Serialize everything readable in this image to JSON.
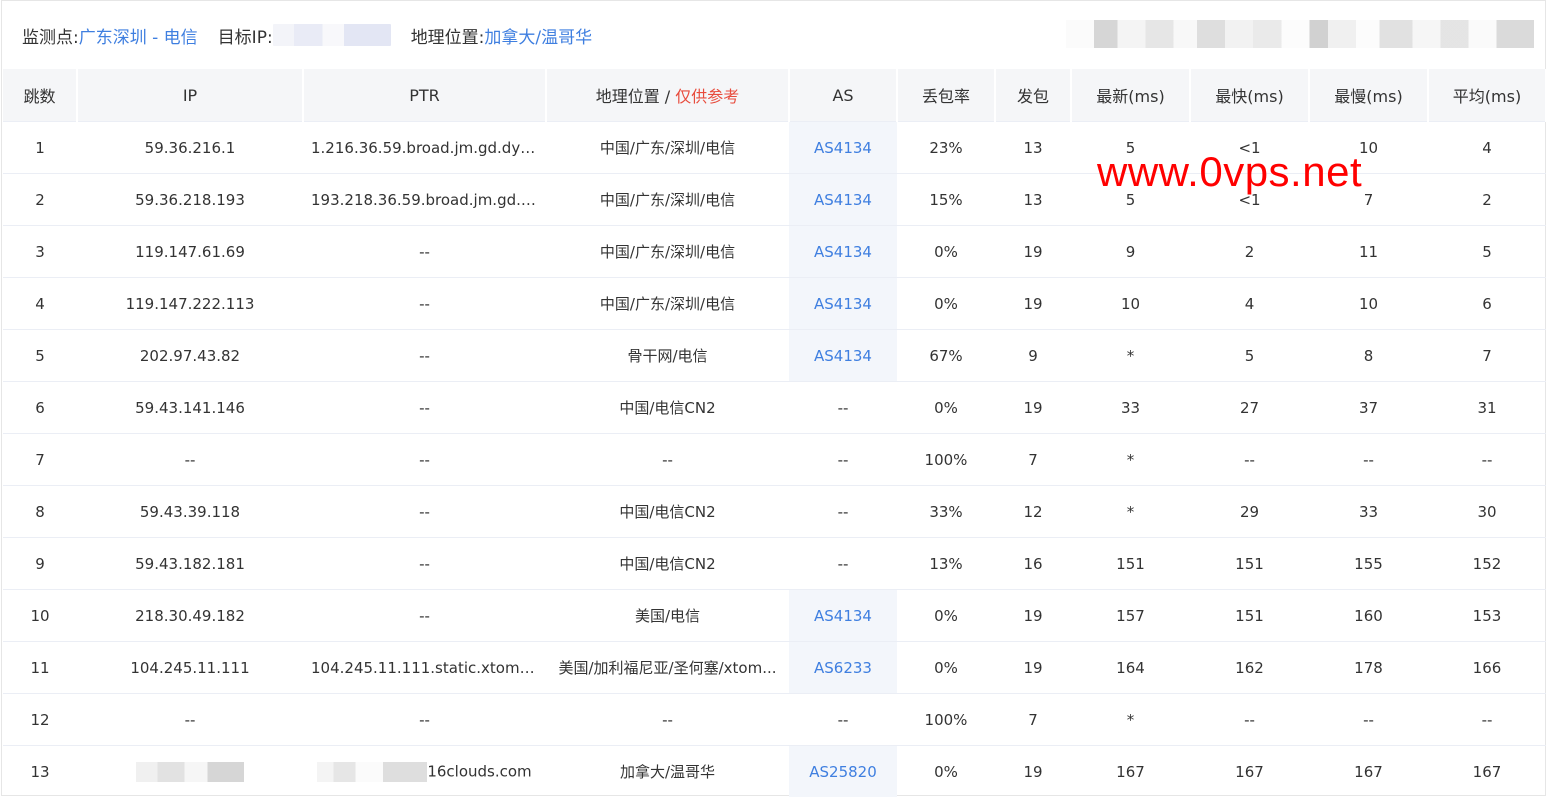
{
  "header": {
    "monitor_label": "监测点:",
    "monitor_value": "广东深圳 - 电信",
    "target_label": "目标IP:",
    "geo_label": "地理位置:",
    "geo_value": "加拿大/温哥华"
  },
  "table": {
    "columns": {
      "hop": "跳数",
      "ip": "IP",
      "ptr": "PTR",
      "geo": "地理位置 /",
      "geo_note": "仅供参考",
      "as": "AS",
      "loss": "丢包率",
      "sent": "发包",
      "last": "最新(ms)",
      "best": "最快(ms)",
      "worst": "最慢(ms)",
      "avg": "平均(ms)"
    },
    "rows": [
      {
        "hop": "1",
        "ip": "59.36.216.1",
        "ptr": "1.216.36.59.broad.jm.gd.dyn...",
        "geo": "中国/广东/深圳/电信",
        "as": "AS4134",
        "loss": "23%",
        "sent": "13",
        "last": "5",
        "best": "<1",
        "worst": "10",
        "avg": "4"
      },
      {
        "hop": "2",
        "ip": "59.36.218.193",
        "ptr": "193.218.36.59.broad.jm.gd.d...",
        "geo": "中国/广东/深圳/电信",
        "as": "AS4134",
        "loss": "15%",
        "sent": "13",
        "last": "5",
        "best": "<1",
        "worst": "7",
        "avg": "2"
      },
      {
        "hop": "3",
        "ip": "119.147.61.69",
        "ptr": "--",
        "geo": "中国/广东/深圳/电信",
        "as": "AS4134",
        "loss": "0%",
        "sent": "19",
        "last": "9",
        "best": "2",
        "worst": "11",
        "avg": "5"
      },
      {
        "hop": "4",
        "ip": "119.147.222.113",
        "ptr": "--",
        "geo": "中国/广东/深圳/电信",
        "as": "AS4134",
        "loss": "0%",
        "sent": "19",
        "last": "10",
        "best": "4",
        "worst": "10",
        "avg": "6"
      },
      {
        "hop": "5",
        "ip": "202.97.43.82",
        "ptr": "--",
        "geo": "骨干网/电信",
        "as": "AS4134",
        "loss": "67%",
        "sent": "9",
        "last": "*",
        "best": "5",
        "worst": "8",
        "avg": "7"
      },
      {
        "hop": "6",
        "ip": "59.43.141.146",
        "ptr": "--",
        "geo": "中国/电信CN2",
        "as": "--",
        "loss": "0%",
        "sent": "19",
        "last": "33",
        "best": "27",
        "worst": "37",
        "avg": "31"
      },
      {
        "hop": "7",
        "ip": "--",
        "ptr": "--",
        "geo": "--",
        "as": "--",
        "loss": "100%",
        "sent": "7",
        "last": "*",
        "best": "--",
        "worst": "--",
        "avg": "--"
      },
      {
        "hop": "8",
        "ip": "59.43.39.118",
        "ptr": "--",
        "geo": "中国/电信CN2",
        "as": "--",
        "loss": "33%",
        "sent": "12",
        "last": "*",
        "best": "29",
        "worst": "33",
        "avg": "30"
      },
      {
        "hop": "9",
        "ip": "59.43.182.181",
        "ptr": "--",
        "geo": "中国/电信CN2",
        "as": "--",
        "loss": "13%",
        "sent": "16",
        "last": "151",
        "best": "151",
        "worst": "155",
        "avg": "152"
      },
      {
        "hop": "10",
        "ip": "218.30.49.182",
        "ptr": "--",
        "geo": "美国/电信",
        "as": "AS4134",
        "loss": "0%",
        "sent": "19",
        "last": "157",
        "best": "151",
        "worst": "160",
        "avg": "153"
      },
      {
        "hop": "11",
        "ip": "104.245.11.111",
        "ptr": "104.245.11.111.static.xtom.c...",
        "geo": "美国/加利福尼亚/圣何塞/xtom...",
        "as": "AS6233",
        "loss": "0%",
        "sent": "19",
        "last": "164",
        "best": "162",
        "worst": "178",
        "avg": "166"
      },
      {
        "hop": "12",
        "ip": "--",
        "ptr": "--",
        "geo": "--",
        "as": "--",
        "loss": "100%",
        "sent": "7",
        "last": "*",
        "best": "--",
        "worst": "--",
        "avg": "--"
      },
      {
        "hop": "13",
        "ip": "",
        "ptr": "16clouds.com",
        "geo": "加拿大/温哥华",
        "as": "AS25820",
        "loss": "0%",
        "sent": "19",
        "last": "167",
        "best": "167",
        "worst": "167",
        "avg": "167"
      }
    ]
  },
  "watermark": "www.0vps.net"
}
